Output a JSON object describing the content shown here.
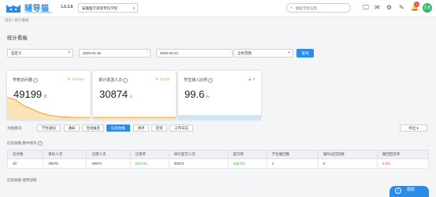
{
  "app": {
    "logo_text": "辅导猫",
    "logo_sub": "Counselor Assistant",
    "version": "1.6.3.8",
    "school": "安徽医学高等专科学校"
  },
  "header": {
    "search_placeholder": "搜索学生信息",
    "notification_count": "0",
    "avatar_text": "王老"
  },
  "breadcrumb": {
    "home": "首页",
    "separator": "/",
    "current": "统计看板"
  },
  "page": {
    "title": "统计看板"
  },
  "filters": {
    "range": "自定义",
    "date_start": "2020-01-26",
    "date_end": "2020-03-22",
    "scope": "全校范围",
    "query_label": "查询"
  },
  "cards": [
    {
      "title": "学校访问量",
      "compare": "▼ 104494",
      "value": "49199",
      "unit": "次",
      "color": "#f0a030",
      "trend": [
        95,
        85,
        60,
        45,
        30,
        20,
        15,
        12,
        10,
        10,
        10
      ]
    },
    {
      "title": "累计发送人次",
      "compare": "▼ 51295",
      "value": "30874",
      "unit": "人",
      "color": "#f0a030",
      "trend": [
        10,
        10,
        10,
        10,
        10,
        10,
        10,
        10,
        10,
        10,
        10
      ]
    },
    {
      "title": "学生接入比例",
      "compare": "▲ 7",
      "value": "99.6",
      "unit": "%",
      "color": "#2b8be8",
      "trend": []
    }
  ],
  "modules": {
    "label": "功能模块:",
    "items": [
      "学生通讯",
      "通知",
      "活动报名",
      "信息收集",
      "测评",
      "签到",
      "工作日志"
    ],
    "active_index": 3,
    "export_label": "导出 ▾"
  },
  "section_overall": {
    "title": "信息收集-整体情况",
    "info": "?"
  },
  "table": {
    "headers": [
      "任务数",
      "目标人次",
      "已建人次",
      "已建率",
      "填写提交人次",
      "提交率",
      "学生撤回数",
      "辅导员回答数",
      "撤回回答率"
    ],
    "rows": [
      [
        "30",
        "30576",
        "30574",
        "100.0%",
        "30573",
        "100.0%",
        "1",
        "0",
        "0.0%"
      ]
    ]
  },
  "section_usage": {
    "title": "信息收集-使用详情"
  },
  "help": {
    "label": "帮助"
  }
}
